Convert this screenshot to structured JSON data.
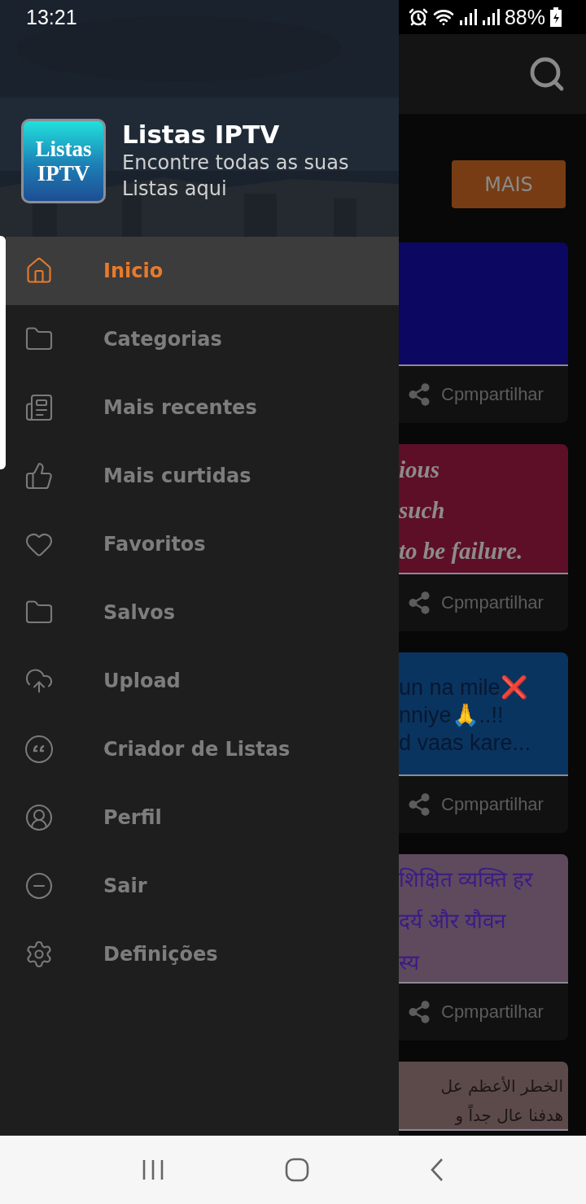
{
  "status_bar": {
    "time": "13:21",
    "battery": "88%"
  },
  "drawer": {
    "header": {
      "kind": "picture"
    },
    "logo_lines": [
      "Listas",
      "IPTV"
    ],
    "title": "Listas IPTV",
    "subtitle_lines": [
      "Encontre todas as suas",
      "Listas aqui"
    ],
    "items": [
      {
        "label": "Inicio",
        "selected": true
      },
      {
        "label": "Categorias",
        "selected": false
      },
      {
        "label": "Mais recentes",
        "selected": false
      },
      {
        "label": "Mais curtidas",
        "selected": false
      },
      {
        "label": "Favoritos",
        "selected": false
      },
      {
        "label": "Salvos",
        "selected": false
      },
      {
        "label": "Upload",
        "selected": false
      },
      {
        "label": "Criador de Listas",
        "selected": false
      },
      {
        "label": "Perfil",
        "selected": false
      },
      {
        "label": "Sair",
        "selected": false
      },
      {
        "label": "Definições",
        "selected": false
      }
    ]
  },
  "filter_button": "MAIS",
  "cards": [
    {
      "kind": "blank",
      "color": "#0c0760",
      "share": "Cpmpartilhar"
    },
    {
      "kind": "script",
      "color": "#5e0f28",
      "lines": [
        "ious",
        "such",
        "to be failure."
      ],
      "share": "Cpmpartilhar"
    },
    {
      "kind": "plain",
      "color": "#0a3460",
      "lines": [
        "un na mile❌",
        "nniye🙏..!!",
        "d vaas kare..."
      ],
      "share": "Cpmpartilhar"
    },
    {
      "kind": "devanagari",
      "color": "#5e4a5c",
      "lines": [
        "शिक्षित व्यक्ति हर",
        "दर्य और यौवन",
        "स्य"
      ],
      "share": "Cpmpartilhar"
    },
    {
      "kind": "arabic",
      "color": "#5c4a4a",
      "lines": [
        "الخطر الأعظم عل",
        "هدفنا عال جداً و"
      ]
    }
  ]
}
